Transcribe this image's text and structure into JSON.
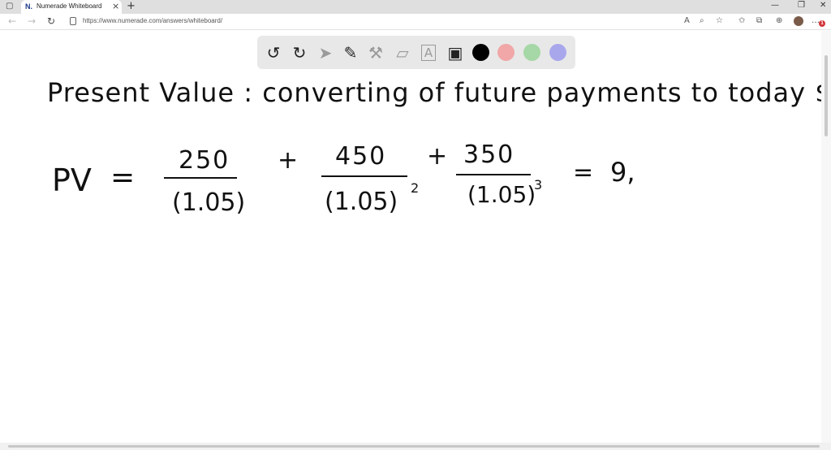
{
  "browser": {
    "tab_title": "Numerade Whiteboard",
    "tab_favicon": "N.",
    "url": "https://www.numerade.com/answers/whiteboard/",
    "badge_count": "1"
  },
  "toolbar": {
    "tools": [
      {
        "name": "undo-icon",
        "glyph": "↺"
      },
      {
        "name": "redo-icon",
        "glyph": "↻"
      },
      {
        "name": "select-pointer-icon",
        "glyph": "➤"
      },
      {
        "name": "pen-icon",
        "glyph": "✎"
      },
      {
        "name": "tools-icon",
        "glyph": "⚒"
      },
      {
        "name": "eraser-icon",
        "glyph": "▱"
      },
      {
        "name": "text-tool-icon",
        "glyph": "A"
      },
      {
        "name": "image-tool-icon",
        "glyph": "▣"
      }
    ],
    "colors": [
      "#000000",
      "#f1a7a7",
      "#a6d7a6",
      "#a9a7ec"
    ]
  },
  "whiteboard": {
    "heading": "Present Value : converting of future payments to today $'s",
    "pv_label": "PV",
    "equals_1": "=",
    "term1_num": "250",
    "term1_den": "(1.05)",
    "plus_1": "+",
    "term2_num": "450",
    "term2_den": "(1.05)",
    "term2_exp": "2",
    "plus_2": "+",
    "term3_num": "350",
    "term3_den": "(1.05)",
    "term3_exp": "3",
    "equals_2": "=",
    "result": "9,"
  }
}
